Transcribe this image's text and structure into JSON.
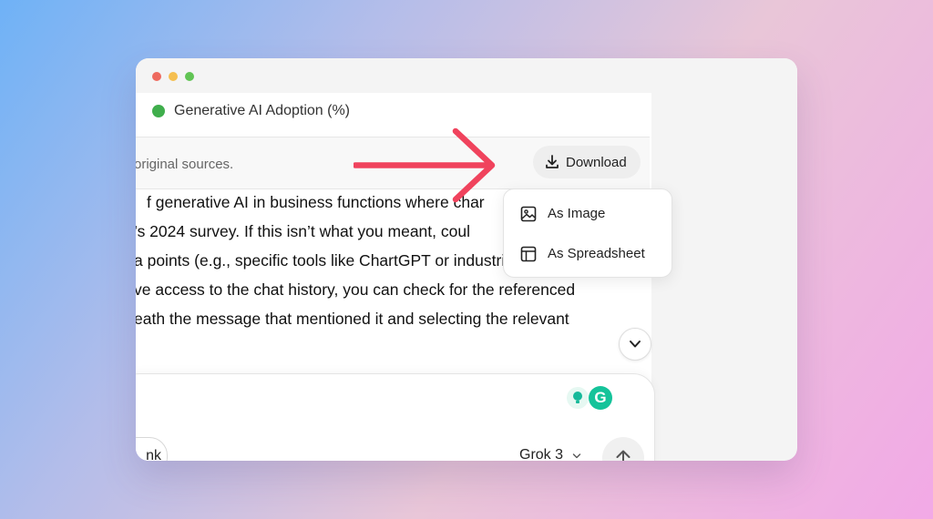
{
  "window": {
    "buttons": [
      "close",
      "minimize",
      "zoom"
    ]
  },
  "legend": {
    "label": "Generative AI Adoption (%)",
    "color": "#3fae4c"
  },
  "sources": {
    "text": "original sources."
  },
  "download": {
    "label": "Download",
    "icon": "download-icon"
  },
  "menu": {
    "items": [
      {
        "label": "As Image",
        "icon": "image-icon"
      },
      {
        "label": "As Spreadsheet",
        "icon": "table-icon"
      }
    ]
  },
  "message": {
    "lines": [
      "f generative AI in business functions where char",
      "’s 2024 survey. If this isn’t what you meant, coul",
      "a points (e.g., specific tools like ChartGPT or industries) you were",
      "ve access to the chat history, you can check for the referenced",
      "eath the message that mentioned it and selecting the relevant"
    ]
  },
  "composer": {
    "think_label": "nk",
    "model_label": "Grok 3",
    "extensions": {
      "grammarly_letter": "G"
    }
  },
  "annotation": {
    "arrow_color": "#f0435d"
  }
}
